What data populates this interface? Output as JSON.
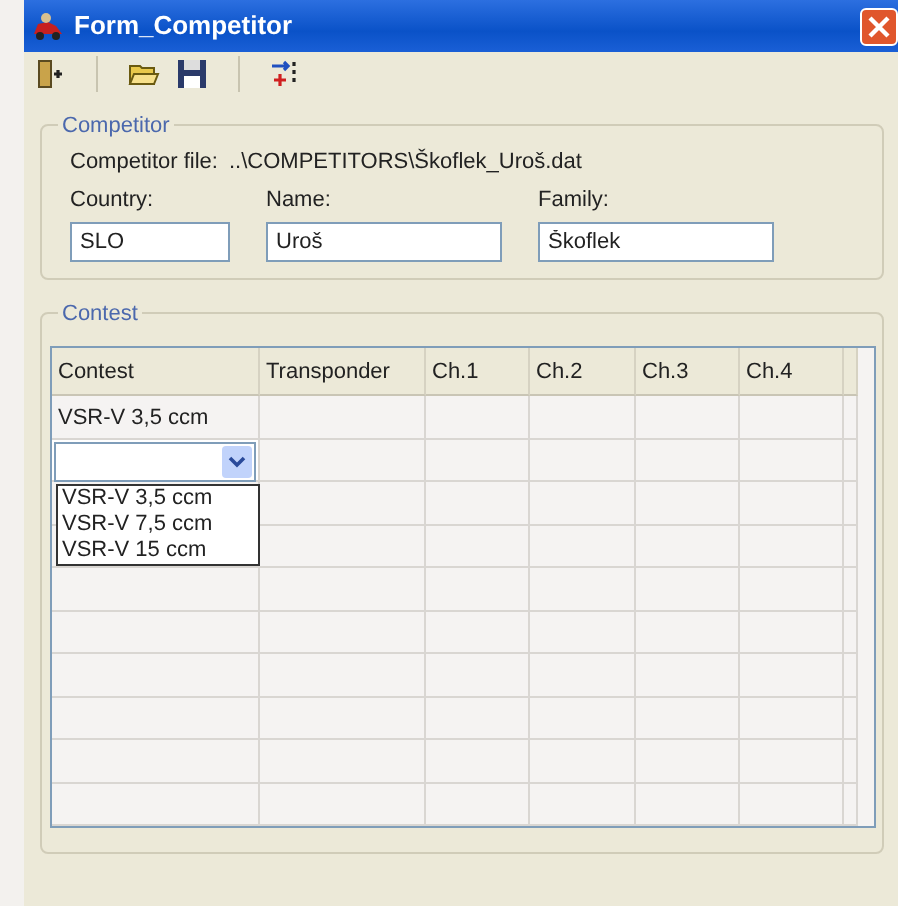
{
  "window": {
    "title": "Form_Competitor"
  },
  "toolbar": [
    {
      "kind": "exit"
    },
    {
      "kind": "open"
    },
    {
      "kind": "save"
    },
    {
      "kind": "arrows"
    }
  ],
  "competitor": {
    "legend": "Competitor",
    "file_label": "Competitor file:",
    "file_path": "..\\COMPETITORS\\Škoflek_Uroš.dat",
    "fields": [
      {
        "label": "Country:",
        "value": "SLO"
      },
      {
        "label": "Name:",
        "value": "Uroš"
      },
      {
        "label": "Family:",
        "value": "Škoflek"
      }
    ]
  },
  "contest": {
    "legend": "Contest",
    "columns": [
      "Contest",
      "Transponder",
      "Ch.1",
      "Ch.2",
      "Ch.3",
      "Ch.4"
    ],
    "rows": [
      {
        "kind": "text",
        "contest": "VSR-V 3,5 ccm"
      },
      {
        "kind": "combo",
        "expanded": true,
        "options": [
          "VSR-V 3,5 ccm",
          "VSR-V 7,5 ccm",
          "VSR-V 15 ccm"
        ]
      },
      {
        "kind": "empty"
      },
      {
        "kind": "empty"
      },
      {
        "kind": "empty"
      },
      {
        "kind": "empty"
      },
      {
        "kind": "empty"
      },
      {
        "kind": "empty"
      },
      {
        "kind": "empty"
      },
      {
        "kind": "empty"
      }
    ]
  }
}
